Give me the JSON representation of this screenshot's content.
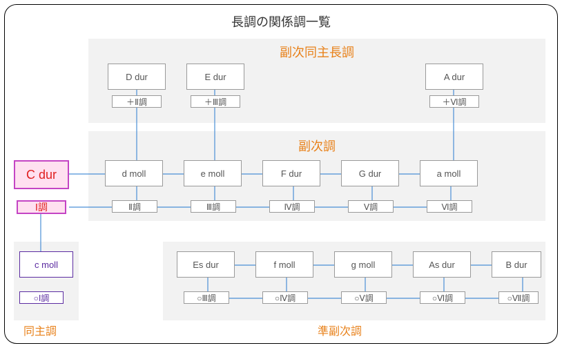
{
  "title": "長調の関係調一覧",
  "sections": {
    "upper": "副次同主長調",
    "middle": "副次調",
    "bottom_left": "同主調",
    "bottom_right": "準副次調"
  },
  "main": {
    "key": "C dur",
    "degree": "Ⅰ調"
  },
  "upper_row": [
    {
      "key": "D dur",
      "degree": "＋Ⅱ調"
    },
    {
      "key": "E dur",
      "degree": "＋Ⅲ調"
    },
    {
      "key": "A dur",
      "degree": "＋Ⅵ調"
    }
  ],
  "middle_row": [
    {
      "key": "d moll",
      "degree": "Ⅱ調"
    },
    {
      "key": "e moll",
      "degree": "Ⅲ調"
    },
    {
      "key": "F dur",
      "degree": "Ⅳ調"
    },
    {
      "key": "G dur",
      "degree": "Ⅴ調"
    },
    {
      "key": "a moll",
      "degree": "Ⅵ調"
    }
  ],
  "parallel": {
    "key": "c moll",
    "degree": "○Ⅰ調"
  },
  "bottom_row": [
    {
      "key": "Es dur",
      "degree": "○Ⅲ調"
    },
    {
      "key": "f moll",
      "degree": "○Ⅳ調"
    },
    {
      "key": "g moll",
      "degree": "○Ⅴ調"
    },
    {
      "key": "As dur",
      "degree": "○Ⅵ調"
    },
    {
      "key": "B dur",
      "degree": "○Ⅶ調"
    }
  ]
}
